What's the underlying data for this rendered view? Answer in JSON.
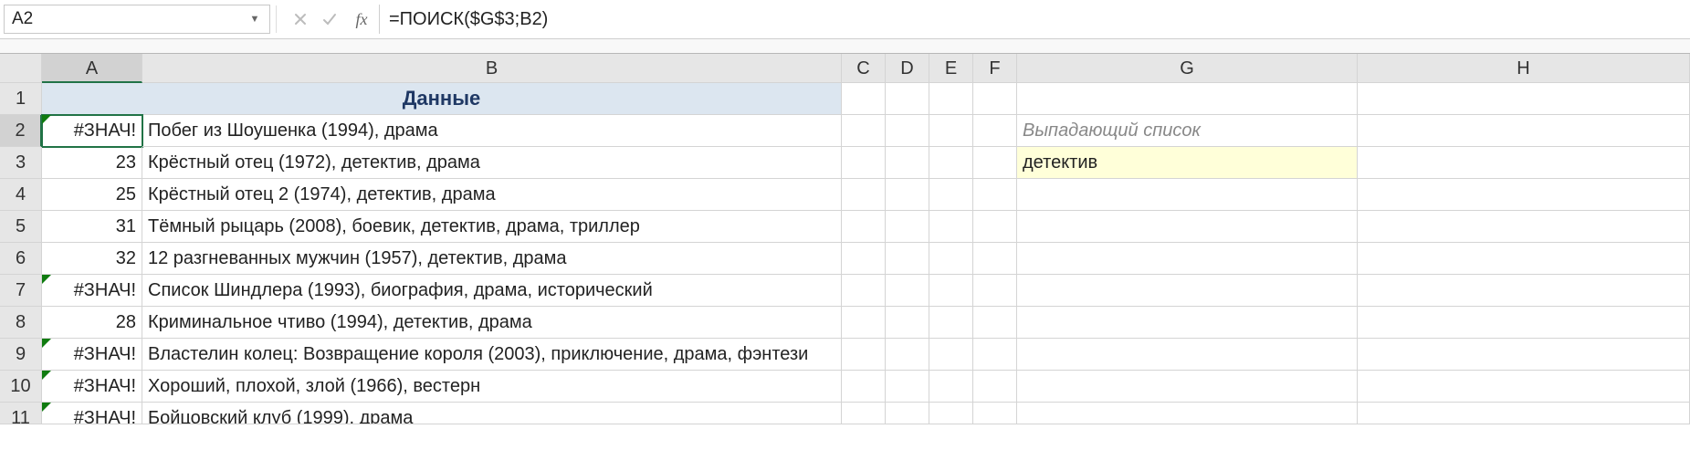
{
  "name_box": "A2",
  "formula": "=ПОИСК($G$3;B2)",
  "fx_label": "fx",
  "columns": [
    "A",
    "B",
    "C",
    "D",
    "E",
    "F",
    "G",
    "H"
  ],
  "rows": [
    "1",
    "2",
    "3",
    "4",
    "5",
    "6",
    "7",
    "8",
    "9",
    "10",
    "11"
  ],
  "header_text": "Данные",
  "a_col": [
    "#ЗНАЧ!",
    "23",
    "25",
    "31",
    "32",
    "#ЗНАЧ!",
    "28",
    "#ЗНАЧ!",
    "#ЗНАЧ!",
    "#ЗНАЧ!"
  ],
  "b_col": [
    "Побег из Шоушенка (1994), драма",
    "Крёстный отец (1972), детектив, драма",
    "Крёстный отец 2 (1974), детектив, драма",
    "Тёмный рыцарь (2008), боевик, детектив, драма, триллер",
    "12 разгневанных мужчин (1957), детектив, драма",
    "Список Шиндлера (1993), биография, драма, исторический",
    "Криминальное чтиво (1994), детектив, драма",
    "Властелин колец: Возвращение короля (2003), приключение, драма, фэнтези",
    "Хороший, плохой, злой (1966), вестерн",
    "Бойцовский клуб (1999), драма"
  ],
  "g2_label": "Выпадающий список",
  "g3_value": "детектив",
  "colors": {
    "accent": "#217346",
    "header_fill": "#dce6f0",
    "header_text": "#1f3864",
    "yellow": "#ffffd9"
  }
}
